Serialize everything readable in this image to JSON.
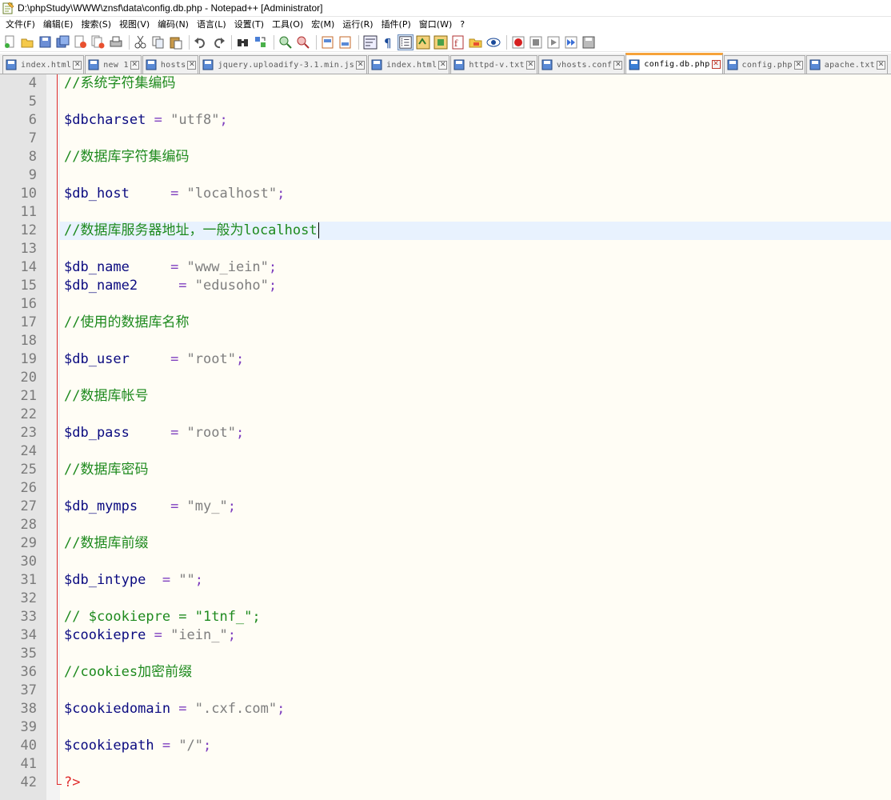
{
  "window": {
    "title": "D:\\phpStudy\\WWW\\znsf\\data\\config.db.php - Notepad++ [Administrator]"
  },
  "menu": [
    "文件(F)",
    "编辑(E)",
    "搜索(S)",
    "视图(V)",
    "编码(N)",
    "语言(L)",
    "设置(T)",
    "工具(O)",
    "宏(M)",
    "运行(R)",
    "插件(P)",
    "窗口(W)",
    "?"
  ],
  "toolbar_icons": [
    "new-file-icon",
    "open-file-icon",
    "save-icon",
    "save-all-icon",
    "close-icon",
    "close-all-icon",
    "print-icon",
    "cut-icon",
    "copy-icon",
    "paste-icon",
    "undo-icon",
    "redo-icon",
    "find-icon",
    "replace-icon",
    "zoom-in-icon",
    "zoom-out-icon",
    "sync-v-icon",
    "sync-h-icon",
    "word-wrap-icon",
    "show-all-chars-icon",
    "indent-guide-icon",
    "user-lang-icon",
    "doc-map-icon",
    "function-list-icon",
    "folder-workspace-icon",
    "monitor-icon",
    "record-macro-icon",
    "stop-macro-icon",
    "play-macro-icon",
    "run-macro-multiple-icon",
    "save-macro-icon"
  ],
  "tabs": [
    {
      "label": "index.html",
      "active": false
    },
    {
      "label": "new 1",
      "active": false
    },
    {
      "label": "hosts",
      "active": false
    },
    {
      "label": "jquery.uploadify-3.1.min.js",
      "active": false
    },
    {
      "label": "index.html",
      "active": false
    },
    {
      "label": "httpd-v.txt",
      "active": false
    },
    {
      "label": "vhosts.conf",
      "active": false
    },
    {
      "label": "config.db.php",
      "active": true
    },
    {
      "label": "config.php",
      "active": false
    },
    {
      "label": "apache.txt",
      "active": false
    }
  ],
  "editor": {
    "current_line": 12,
    "lines": [
      {
        "n": "4",
        "parts": [
          [
            "c-comment",
            "//系统字符集编码"
          ]
        ]
      },
      {
        "n": "5",
        "parts": []
      },
      {
        "n": "6",
        "parts": [
          [
            "c-var",
            "$dbcharset"
          ],
          [
            "c-op",
            " = "
          ],
          [
            "c-str",
            "\"utf8\""
          ],
          [
            "c-op",
            ";"
          ]
        ]
      },
      {
        "n": "7",
        "parts": []
      },
      {
        "n": "8",
        "parts": [
          [
            "c-comment",
            "//数据库字符集编码"
          ]
        ]
      },
      {
        "n": "9",
        "parts": []
      },
      {
        "n": "10",
        "parts": [
          [
            "c-var",
            "$db_host"
          ],
          [
            "c-op",
            "     = "
          ],
          [
            "c-str",
            "\"localhost\""
          ],
          [
            "c-op",
            ";"
          ]
        ]
      },
      {
        "n": "11",
        "parts": []
      },
      {
        "n": "12",
        "parts": [
          [
            "c-comment",
            "//数据库服务器地址，一般为localhost"
          ]
        ]
      },
      {
        "n": "13",
        "parts": []
      },
      {
        "n": "14",
        "parts": [
          [
            "c-var",
            "$db_name"
          ],
          [
            "c-op",
            "     = "
          ],
          [
            "c-str",
            "\"www_iein\""
          ],
          [
            "c-op",
            ";"
          ]
        ]
      },
      {
        "n": "15",
        "parts": [
          [
            "c-var",
            "$db_name2"
          ],
          [
            "c-op",
            "     = "
          ],
          [
            "c-str",
            "\"edusoho\""
          ],
          [
            "c-op",
            ";"
          ]
        ]
      },
      {
        "n": "16",
        "parts": []
      },
      {
        "n": "17",
        "parts": [
          [
            "c-comment",
            "//使用的数据库名称"
          ]
        ]
      },
      {
        "n": "18",
        "parts": []
      },
      {
        "n": "19",
        "parts": [
          [
            "c-var",
            "$db_user"
          ],
          [
            "c-op",
            "     = "
          ],
          [
            "c-str",
            "\"root\""
          ],
          [
            "c-op",
            ";"
          ]
        ]
      },
      {
        "n": "20",
        "parts": []
      },
      {
        "n": "21",
        "parts": [
          [
            "c-comment",
            "//数据库帐号"
          ]
        ]
      },
      {
        "n": "22",
        "parts": []
      },
      {
        "n": "23",
        "parts": [
          [
            "c-var",
            "$db_pass"
          ],
          [
            "c-op",
            "     = "
          ],
          [
            "c-str",
            "\"root\""
          ],
          [
            "c-op",
            ";"
          ]
        ]
      },
      {
        "n": "24",
        "parts": []
      },
      {
        "n": "25",
        "parts": [
          [
            "c-comment",
            "//数据库密码"
          ]
        ]
      },
      {
        "n": "26",
        "parts": []
      },
      {
        "n": "27",
        "parts": [
          [
            "c-var",
            "$db_mymps"
          ],
          [
            "c-op",
            "    = "
          ],
          [
            "c-str",
            "\"my_\""
          ],
          [
            "c-op",
            ";"
          ]
        ]
      },
      {
        "n": "28",
        "parts": []
      },
      {
        "n": "29",
        "parts": [
          [
            "c-comment",
            "//数据库前缀"
          ]
        ]
      },
      {
        "n": "30",
        "parts": []
      },
      {
        "n": "31",
        "parts": [
          [
            "c-var",
            "$db_intype"
          ],
          [
            "c-op",
            "  = "
          ],
          [
            "c-str",
            "\"\""
          ],
          [
            "c-op",
            ";"
          ]
        ]
      },
      {
        "n": "32",
        "parts": []
      },
      {
        "n": "33",
        "parts": [
          [
            "c-comment",
            "// $cookiepre = \"1tnf_\";"
          ]
        ]
      },
      {
        "n": "34",
        "parts": [
          [
            "c-var",
            "$cookiepre"
          ],
          [
            "c-op",
            " = "
          ],
          [
            "c-str",
            "\"iein_\""
          ],
          [
            "c-op",
            ";"
          ]
        ]
      },
      {
        "n": "35",
        "parts": []
      },
      {
        "n": "36",
        "parts": [
          [
            "c-comment",
            "//cookies加密前缀"
          ]
        ]
      },
      {
        "n": "37",
        "parts": []
      },
      {
        "n": "38",
        "parts": [
          [
            "c-var",
            "$cookiedomain"
          ],
          [
            "c-op",
            " = "
          ],
          [
            "c-str",
            "\".cxf.com\""
          ],
          [
            "c-op",
            ";"
          ]
        ]
      },
      {
        "n": "39",
        "parts": []
      },
      {
        "n": "40",
        "parts": [
          [
            "c-var",
            "$cookiepath"
          ],
          [
            "c-op",
            " = "
          ],
          [
            "c-str",
            "\"/\""
          ],
          [
            "c-op",
            ";"
          ]
        ]
      },
      {
        "n": "41",
        "parts": []
      },
      {
        "n": "42",
        "parts": [
          [
            "c-end",
            "?>"
          ]
        ]
      }
    ]
  }
}
